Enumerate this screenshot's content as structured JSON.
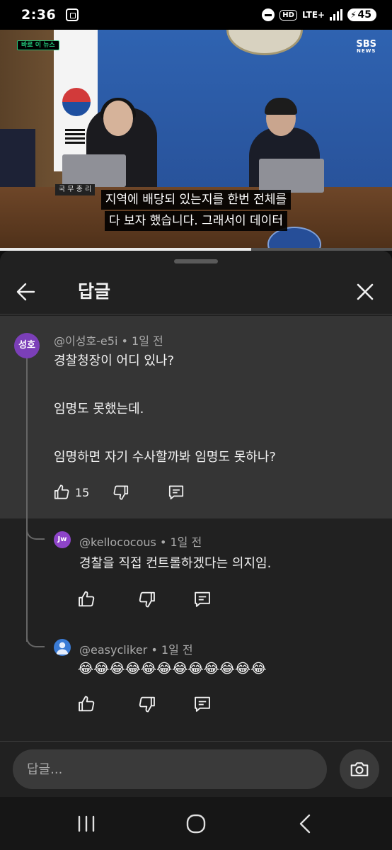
{
  "status_bar": {
    "time": "2:36",
    "hd": "HD",
    "network": "LTE+",
    "battery": "45"
  },
  "video": {
    "live_badge": "바로 이 뉴스",
    "channel_logo_top": "SBS",
    "channel_logo_bottom": "NEWS",
    "nameplate": "국 무 총 리",
    "subtitle_line1": "지역에 배당되 있는지를 한번 전체를",
    "subtitle_line2": "다 보자 했습니다. 그래서이 데이터",
    "progress_fraction": 0.64
  },
  "panel": {
    "title": "답글",
    "back_icon": "arrow-left-icon",
    "close_icon": "close-icon"
  },
  "parent_comment": {
    "avatar_text": "성호",
    "author": "@이성호-e5i",
    "time": "1일 전",
    "lines": [
      "경찰청장이 어디  있나?",
      "임명도 못했는데.",
      "임명하면 자기 수사할까봐 임명도 못하나?"
    ],
    "likes": "15"
  },
  "replies": [
    {
      "avatar_text": "Jw",
      "author": "@kellococous",
      "time": "1일 전",
      "text": "경찰을 직접 컨트롤하겠다는 의지임."
    },
    {
      "avatar_text": "",
      "author": "@easycliker",
      "time": "1일 전",
      "text": "😂😂😂😂😂😂😂😂😂😂😂😂"
    }
  ],
  "footer": {
    "reply_placeholder": "답글...",
    "camera_icon": "camera-icon"
  },
  "colors": {
    "panel_bg": "#212121",
    "highlight_bg": "#353535",
    "avatar_main": "#7b3fb8",
    "avatar_jw": "#8e44c9",
    "avatar_easy": "#3a7bd5",
    "live_badge": "#21c77a"
  }
}
